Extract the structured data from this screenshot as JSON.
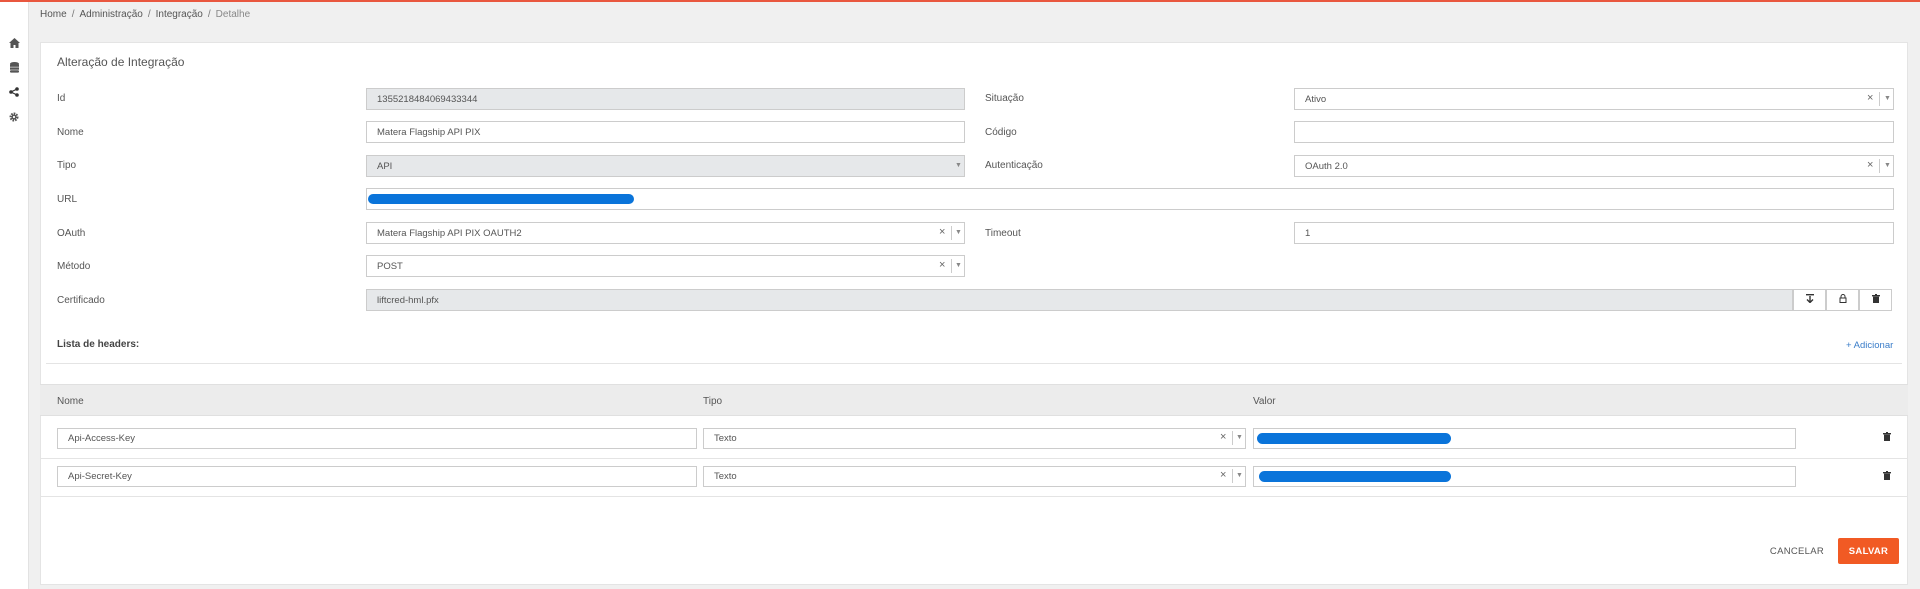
{
  "breadcrumb": [
    "Home",
    "Administração",
    "Integração",
    "Detalhe"
  ],
  "sidebar": {
    "icons": [
      "home-icon",
      "database-icon",
      "share-icon",
      "gear-icon"
    ]
  },
  "form": {
    "title": "Alteração de Integração",
    "id_label": "Id",
    "id_value": "1355218484069433344",
    "situacao_label": "Situação",
    "situacao_value": "Ativo",
    "nome_label": "Nome",
    "nome_value": "Matera Flagship API PIX",
    "codigo_label": "Código",
    "codigo_value": "",
    "tipo_label": "Tipo",
    "tipo_value": "API",
    "autenticacao_label": "Autenticação",
    "autenticacao_value": "OAuth 2.0",
    "url_label": "URL",
    "oauth_label": "OAuth",
    "oauth_value": "Matera Flagship API PIX OAUTH2",
    "timeout_label": "Timeout",
    "timeout_value": "1",
    "metodo_label": "Método",
    "metodo_value": "POST",
    "certificado_label": "Certificado",
    "certificado_value": "liftcred-hml.pfx"
  },
  "headers": {
    "title": "Lista de headers:",
    "add_label": "+ Adicionar",
    "columns": [
      "Nome",
      "Tipo",
      "Valor"
    ],
    "rows": [
      {
        "nome": "Api-Access-Key",
        "tipo": "Texto"
      },
      {
        "nome": "Api-Secret-Key",
        "tipo": "Texto"
      }
    ]
  },
  "actions": {
    "cancel_label": "CANCELAR",
    "save_label": "SALVAR"
  },
  "colors": {
    "accent": "#f15a24",
    "redaction": "#0a74da",
    "link": "#3a7dc9"
  }
}
